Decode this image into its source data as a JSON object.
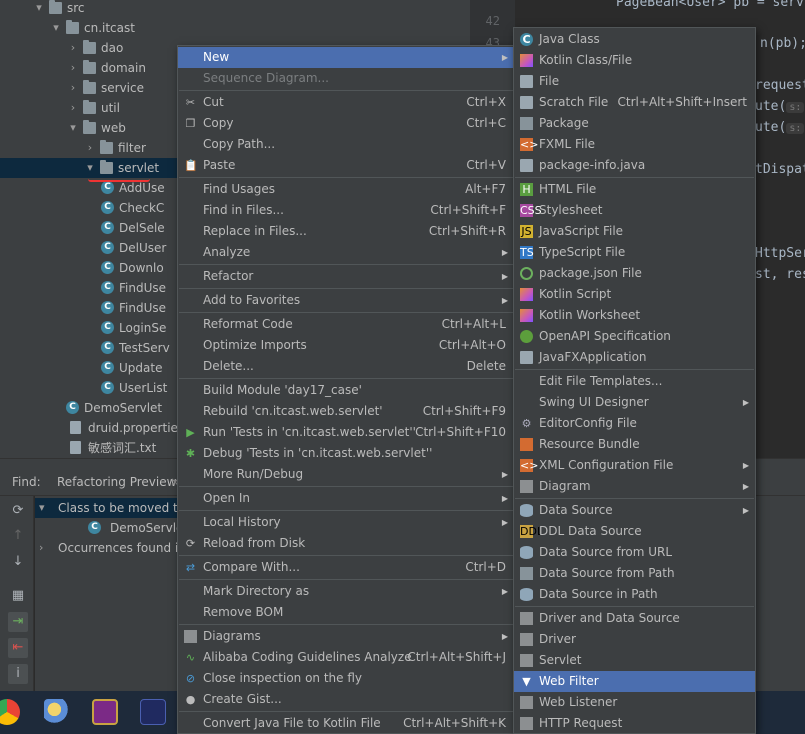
{
  "tree": {
    "rows": [
      {
        "label": "src",
        "icon": "folder-icon",
        "arrow": "down"
      },
      {
        "label": "cn.itcast",
        "icon": "folder-icon",
        "arrow": "down"
      },
      {
        "label": "dao",
        "icon": "folder-icon",
        "arrow": "right"
      },
      {
        "label": "domain",
        "icon": "folder-icon",
        "arrow": "right"
      },
      {
        "label": "service",
        "icon": "folder-icon",
        "arrow": "right"
      },
      {
        "label": "util",
        "icon": "folder-icon",
        "arrow": "right"
      },
      {
        "label": "web",
        "icon": "folder-icon",
        "arrow": "down"
      },
      {
        "label": "filter",
        "icon": "folder-icon",
        "arrow": "right"
      },
      {
        "label": "servlet",
        "icon": "folder-icon",
        "arrow": "down",
        "selected": true
      },
      {
        "label": "AddUse",
        "icon": "class-icon"
      },
      {
        "label": "CheckC",
        "icon": "class-icon"
      },
      {
        "label": "DelSele",
        "icon": "class-icon"
      },
      {
        "label": "DelUser",
        "icon": "class-icon"
      },
      {
        "label": "Downlo",
        "icon": "class-icon"
      },
      {
        "label": "FindUse",
        "icon": "class-icon"
      },
      {
        "label": "FindUse",
        "icon": "class-icon"
      },
      {
        "label": "LoginSe",
        "icon": "class-icon"
      },
      {
        "label": "TestServ",
        "icon": "class-icon"
      },
      {
        "label": "Update",
        "icon": "class-icon"
      },
      {
        "label": "UserList",
        "icon": "class-icon"
      },
      {
        "label": "DemoServlet",
        "icon": "class-icon"
      },
      {
        "label": "druid.properties",
        "icon": "properties-file-icon"
      },
      {
        "label": "敏感词汇.txt",
        "icon": "text-file-icon"
      }
    ]
  },
  "editor": {
    "lines": [
      "42",
      "43"
    ],
    "code": [
      {
        "text": "PageBean<User> pb = serv"
      },
      {
        "text": "n(pb);"
      },
      {
        "text": "request"
      },
      {
        "text": "ute("
      },
      {
        "text": "ute("
      },
      {
        "text": "tDispat"
      },
      {
        "text": "HttpSer"
      },
      {
        "text": "st, res"
      }
    ]
  },
  "find": {
    "title": "Find:",
    "tab": "Refactoring Preview",
    "tab_close": "×",
    "rows": [
      {
        "label": "Class to be moved to c",
        "arrow": "down",
        "selected": true
      },
      {
        "label": "DemoServlet",
        "icon": "class-icon"
      },
      {
        "label": "Occurrences found in c",
        "arrow": "right"
      }
    ]
  },
  "menu": {
    "items": [
      {
        "label": "New",
        "highlight": true,
        "submenu": true
      },
      {
        "label": "Sequence Diagram...",
        "disabled": true,
        "icon": "sequence-diagram-icon"
      },
      {
        "sep": true
      },
      {
        "label": "Cut",
        "shortcut": "Ctrl+X",
        "icon": "scissors-icon"
      },
      {
        "label": "Copy",
        "shortcut": "Ctrl+C",
        "icon": "copy-icon"
      },
      {
        "label": "Copy Path...",
        "shortcut": ""
      },
      {
        "label": "Paste",
        "shortcut": "Ctrl+V",
        "icon": "paste-icon"
      },
      {
        "sep": true
      },
      {
        "label": "Find Usages",
        "shortcut": "Alt+F7"
      },
      {
        "label": "Find in Files...",
        "shortcut": "Ctrl+Shift+F"
      },
      {
        "label": "Replace in Files...",
        "shortcut": "Ctrl+Shift+R"
      },
      {
        "label": "Analyze",
        "submenu": true
      },
      {
        "sep": true
      },
      {
        "label": "Refactor",
        "submenu": true
      },
      {
        "sep": true
      },
      {
        "label": "Add to Favorites",
        "submenu": true
      },
      {
        "sep": true
      },
      {
        "label": "Reformat Code",
        "shortcut": "Ctrl+Alt+L"
      },
      {
        "label": "Optimize Imports",
        "shortcut": "Ctrl+Alt+O"
      },
      {
        "label": "Delete...",
        "shortcut": "Delete"
      },
      {
        "sep": true
      },
      {
        "label": "Build Module 'day17_case'",
        "shortcut": ""
      },
      {
        "label": "Rebuild 'cn.itcast.web.servlet'",
        "shortcut": "Ctrl+Shift+F9"
      },
      {
        "label": "Run 'Tests in 'cn.itcast.web.servlet''",
        "shortcut": "Ctrl+Shift+F10",
        "icon": "run-icon"
      },
      {
        "label": "Debug 'Tests in 'cn.itcast.web.servlet''",
        "shortcut": "",
        "icon": "debug-icon"
      },
      {
        "label": "More Run/Debug",
        "submenu": true
      },
      {
        "sep": true
      },
      {
        "label": "Open In",
        "submenu": true
      },
      {
        "sep": true
      },
      {
        "label": "Local History",
        "submenu": true
      },
      {
        "label": "Reload from Disk",
        "icon": "reload-icon"
      },
      {
        "sep": true
      },
      {
        "label": "Compare With...",
        "shortcut": "Ctrl+D",
        "icon": "compare-icon"
      },
      {
        "sep": true
      },
      {
        "label": "Mark Directory as",
        "submenu": true
      },
      {
        "label": "Remove BOM"
      },
      {
        "sep": true
      },
      {
        "label": "Diagrams",
        "submenu": true,
        "icon": "diagrams-icon"
      },
      {
        "label": "Alibaba Coding Guidelines Analyze",
        "shortcut": "Ctrl+Alt+Shift+J",
        "icon": "alibaba-icon"
      },
      {
        "label": "Close inspection on the fly",
        "icon": "close-inspection-icon"
      },
      {
        "label": "Create Gist...",
        "icon": "github-icon"
      },
      {
        "sep": true
      },
      {
        "label": "Convert Java File to Kotlin File",
        "shortcut": "Ctrl+Alt+Shift+K"
      }
    ]
  },
  "submenu": {
    "items": [
      {
        "label": "Java Class",
        "icon": "java-class-icon"
      },
      {
        "label": "Kotlin Class/File",
        "icon": "kotlin-icon"
      },
      {
        "label": "File",
        "icon": "file-icon"
      },
      {
        "label": "Scratch File",
        "shortcut": "Ctrl+Alt+Shift+Insert",
        "icon": "scratch-file-icon"
      },
      {
        "label": "Package",
        "icon": "package-icon"
      },
      {
        "label": "FXML File",
        "icon": "fxml-icon"
      },
      {
        "label": "package-info.java",
        "icon": "package-info-icon"
      },
      {
        "sep": true
      },
      {
        "label": "HTML File",
        "icon": "html-icon"
      },
      {
        "label": "Stylesheet",
        "icon": "css-icon"
      },
      {
        "label": "JavaScript File",
        "icon": "js-icon"
      },
      {
        "label": "TypeScript File",
        "icon": "ts-icon"
      },
      {
        "label": "package.json File",
        "icon": "npm-icon"
      },
      {
        "label": "Kotlin Script",
        "icon": "kotlin-script-icon"
      },
      {
        "label": "Kotlin Worksheet",
        "icon": "kotlin-worksheet-icon"
      },
      {
        "label": "OpenAPI Specification",
        "icon": "openapi-icon"
      },
      {
        "label": "JavaFXApplication",
        "icon": "javafx-icon"
      },
      {
        "sep": true
      },
      {
        "label": "Edit File Templates..."
      },
      {
        "label": "Swing UI Designer",
        "submenu": true
      },
      {
        "label": "EditorConfig File",
        "icon": "gear-icon"
      },
      {
        "label": "Resource Bundle",
        "icon": "resource-bundle-icon"
      },
      {
        "label": "XML Configuration File",
        "submenu": true,
        "icon": "xml-icon"
      },
      {
        "label": "Diagram",
        "submenu": true,
        "icon": "diagram-icon"
      },
      {
        "sep": true
      },
      {
        "label": "Data Source",
        "submenu": true,
        "icon": "database-icon"
      },
      {
        "label": "DDL Data Source",
        "icon": "ddl-icon"
      },
      {
        "label": "Data Source from URL",
        "icon": "database-url-icon"
      },
      {
        "label": "Data Source from Path",
        "icon": "folder-open-icon"
      },
      {
        "label": "Data Source in Path",
        "icon": "database-path-icon"
      },
      {
        "sep": true
      },
      {
        "label": "Driver and Data Source",
        "icon": "driver-data-source-icon"
      },
      {
        "label": "Driver",
        "icon": "driver-icon"
      },
      {
        "label": "Servlet",
        "icon": "servlet-icon"
      },
      {
        "label": "Web Filter",
        "highlight": true,
        "icon": "filter-icon"
      },
      {
        "label": "Web Listener",
        "icon": "web-listener-icon"
      },
      {
        "label": "HTTP Request",
        "icon": "http-request-icon"
      }
    ]
  },
  "taskbar": {
    "apps": [
      "chrome-icon",
      "paint-icon",
      "intellij-icon",
      "app-icon"
    ]
  },
  "colors": {
    "highlight": "#4b6eaf",
    "menu_bg": "#3c3f41",
    "selection": "#0d293e"
  }
}
